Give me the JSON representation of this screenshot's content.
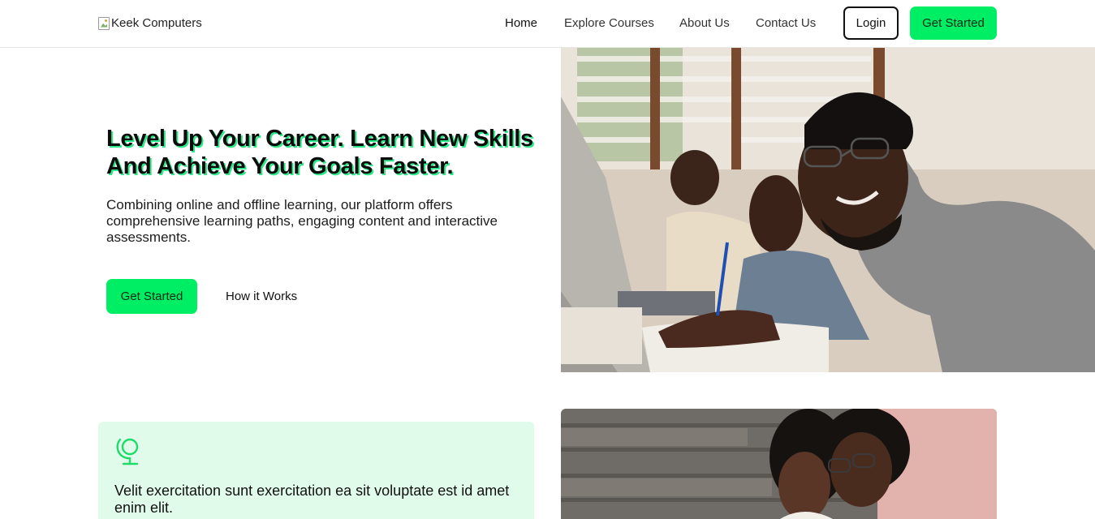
{
  "nav": {
    "logo_alt": "Keek Computers",
    "links": [
      {
        "label": "Home"
      },
      {
        "label": "Explore Courses"
      },
      {
        "label": "About Us"
      },
      {
        "label": "Contact Us"
      }
    ],
    "login_label": "Login",
    "cta_label": "Get Started"
  },
  "hero": {
    "title": "Level Up Your Career. Learn New Skills And Achieve Your Goals Faster.",
    "subtitle": "Combining online and offline learning, our platform offers comprehensive learning paths, engaging content and interactive assessments.",
    "cta_label": "Get Started",
    "secondary_label": "How it Works"
  },
  "feature": {
    "icon": "globe-stand-icon",
    "text": "Velit exercitation sunt exercitation ea sit voluptate est id amet enim elit."
  },
  "colors": {
    "accent": "#00ee64",
    "card_bg": "#e1fbeb",
    "title_shadow": "#2ee88a"
  }
}
